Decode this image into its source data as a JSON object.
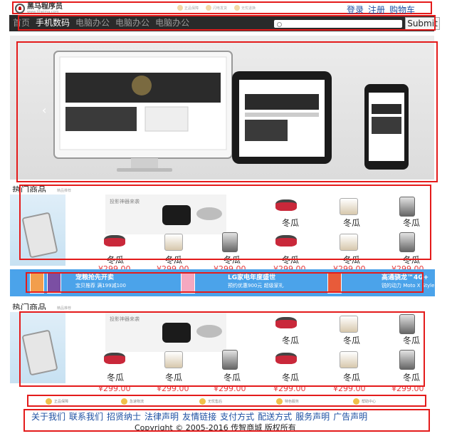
{
  "header": {
    "logo_title": "黑马程序员",
    "logo_sub": "www.itheima.com",
    "badges": [
      "正品保障",
      "闪电发货",
      "无忧退换"
    ],
    "links": [
      "登录",
      "注册",
      "购物车"
    ]
  },
  "nav": {
    "items": [
      "首页",
      "手机数码",
      "电脑办公",
      "电脑办公",
      "电脑办公"
    ],
    "active_index": 1,
    "submit_label": "Submit"
  },
  "banner": {
    "prev_icon": "chevron-left-icon"
  },
  "sections": [
    {
      "title": "热门商品",
      "subtitle": "精品推荐",
      "mid_banner_text": "投影神器来袭"
    },
    {
      "title": "热门商品",
      "subtitle": "精品推荐",
      "mid_banner_text": "投影神器来袭"
    }
  ],
  "products": {
    "name": "冬瓜",
    "price": "¥299.00"
  },
  "promo": {
    "items": [
      {
        "title": "宠粮抢先开卖",
        "sub": "宝贝推荐 满199减100"
      },
      {
        "title": "LG家电年度盛世",
        "sub": "预约优惠900元 超级家礼"
      },
      {
        "title": "高通骁龙™4G+",
        "sub": "锐的动力 Moto X Style"
      }
    ]
  },
  "services": [
    "正品保障",
    "急速物流",
    "无忧售后",
    "特色服务",
    "帮助中心"
  ],
  "footer": {
    "links": [
      "关于我们",
      "联系我们",
      "招贤纳士",
      "法律声明",
      "友情链接",
      "支付方式",
      "配送方式",
      "服务声明",
      "广告声明"
    ],
    "copyright": "Copyright © 2005-2016 传智商城 版权所有"
  }
}
